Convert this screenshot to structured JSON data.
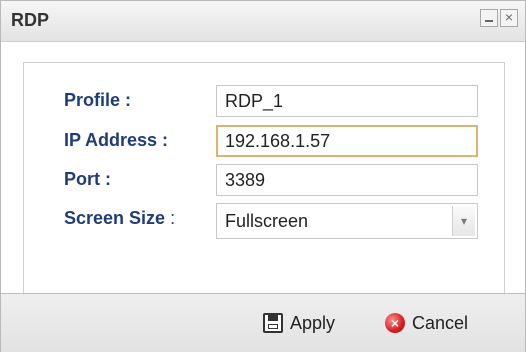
{
  "window": {
    "title": "RDP",
    "minimize_glyph": "–",
    "close_glyph": "×"
  },
  "form": {
    "profile": {
      "label": "Profile :",
      "value": "RDP_1"
    },
    "ip_address": {
      "label": "IP Address :",
      "value": "192.168.1.57"
    },
    "port": {
      "label": "Port :",
      "value": "3389"
    },
    "screen_size": {
      "label": "Screen Size",
      "separator": ":",
      "value": "Fullscreen",
      "arrow": "▾"
    }
  },
  "footer": {
    "apply_label": "Apply",
    "cancel_label": "Cancel",
    "cancel_icon_glyph": "×"
  },
  "colors": {
    "label": "#1f3d7a",
    "focus_border": "#d9b56e",
    "cancel_icon": "#d42020"
  }
}
